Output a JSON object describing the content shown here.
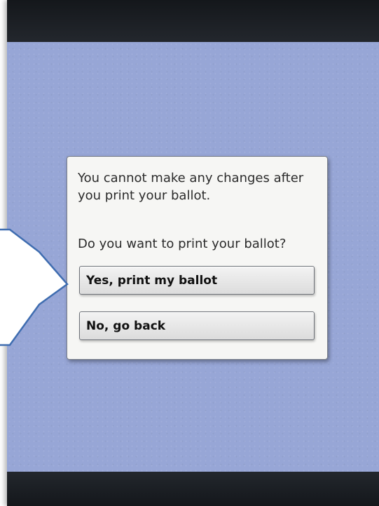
{
  "dialog": {
    "message": "You cannot make any changes after you print your ballot.",
    "question": "Do you want to print your ballot?",
    "yes_label": "Yes, print my ballot",
    "no_label": "No, go back"
  },
  "colors": {
    "background": "#97a6d6",
    "bars": "#1c1f24",
    "callout_border": "#3f6db0",
    "dialog": "#f6f6f4"
  }
}
